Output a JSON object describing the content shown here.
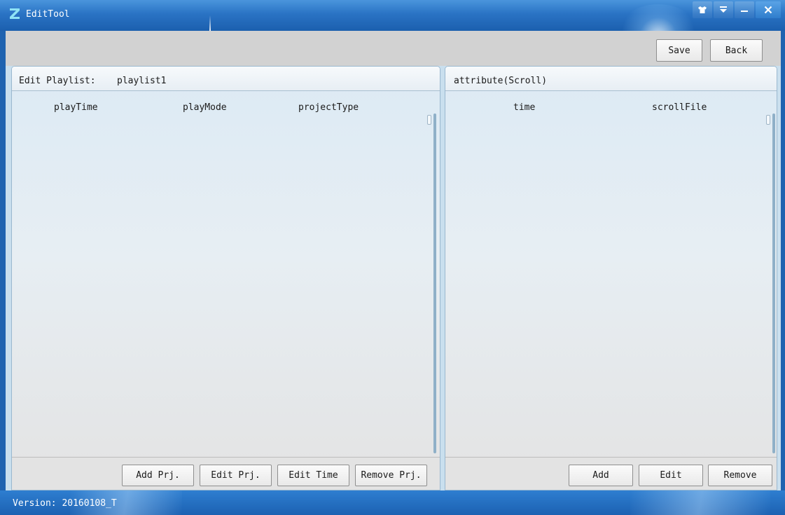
{
  "window": {
    "title": "EditTool",
    "controls": [
      "skin",
      "menu",
      "minimize",
      "close"
    ]
  },
  "toolbar": {
    "save_label": "Save",
    "back_label": "Back"
  },
  "left_panel": {
    "header_label": "Edit Playlist:",
    "playlist_name": "playlist1",
    "columns": [
      "playTime",
      "playMode",
      "projectType"
    ],
    "rows": [],
    "buttons": {
      "add": "Add Prj.",
      "edit": "Edit Prj.",
      "edit_time": "Edit Time",
      "remove": "Remove Prj."
    }
  },
  "right_panel": {
    "header_label": "attribute(Scroll)",
    "columns": [
      "time",
      "scrollFile"
    ],
    "rows": [],
    "buttons": {
      "add": "Add",
      "edit": "Edit",
      "remove": "Remove"
    }
  },
  "status": {
    "version": "Version: 20160108_T"
  },
  "colors": {
    "titlebar": "#2a73c4",
    "panel_background": "#dceaf4",
    "toolbar_background": "#d2d2d2"
  }
}
